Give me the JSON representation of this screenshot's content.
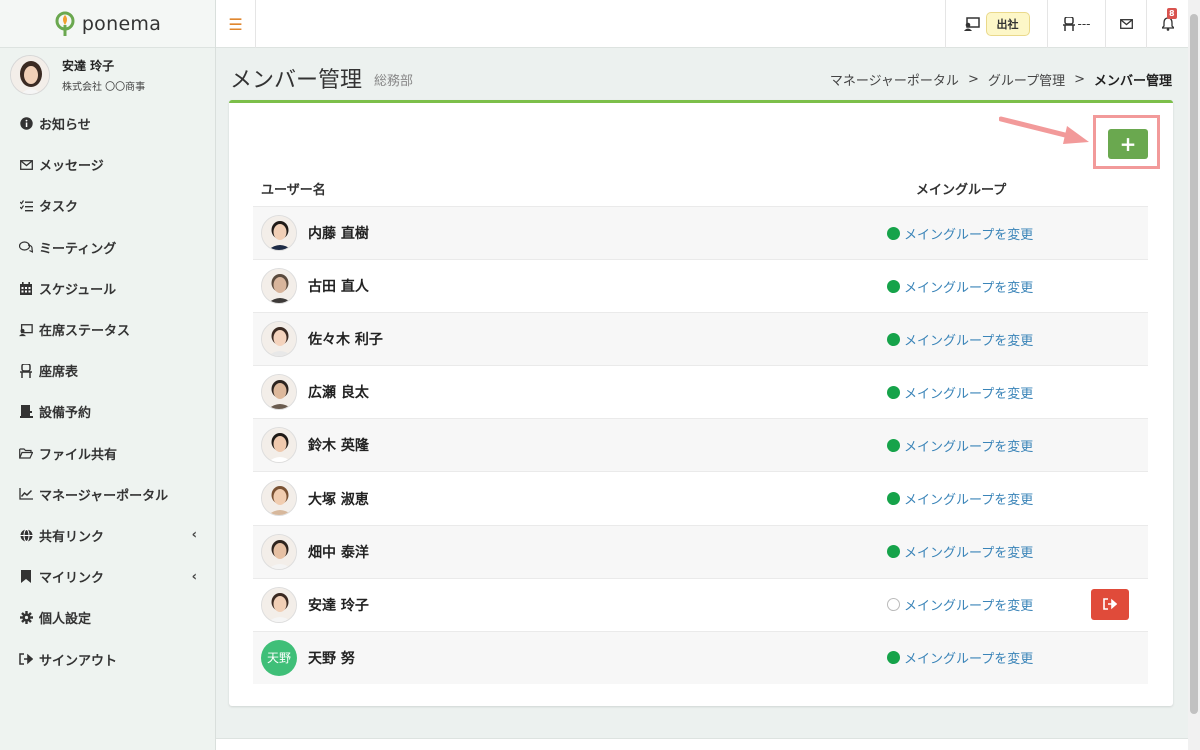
{
  "app": {
    "brand": "ponema"
  },
  "user": {
    "name": "安達 玲子",
    "company": "株式会社 〇〇商事"
  },
  "sidebar": {
    "items": [
      {
        "label": "お知らせ",
        "icon": "info-icon"
      },
      {
        "label": "メッセージ",
        "icon": "envelope-icon"
      },
      {
        "label": "タスク",
        "icon": "task-list-icon"
      },
      {
        "label": "ミーティング",
        "icon": "chat-bubbles-icon"
      },
      {
        "label": "スケジュール",
        "icon": "calendar-icon"
      },
      {
        "label": "在席ステータス",
        "icon": "presence-icon"
      },
      {
        "label": "座席表",
        "icon": "chair-icon"
      },
      {
        "label": "設備予約",
        "icon": "facility-icon"
      },
      {
        "label": "ファイル共有",
        "icon": "folder-icon"
      },
      {
        "label": "マネージャーポータル",
        "icon": "chart-icon"
      },
      {
        "label": "共有リンク",
        "icon": "globe-icon",
        "chevron": "‹"
      },
      {
        "label": "マイリンク",
        "icon": "bookmark-icon",
        "chevron": "‹"
      },
      {
        "label": "個人設定",
        "icon": "gear-icon"
      },
      {
        "label": "サインアウト",
        "icon": "sign-out-icon"
      }
    ]
  },
  "header": {
    "attendance_label": "出社",
    "seat_label": "---",
    "notification_count": "8"
  },
  "page": {
    "title": "メンバー管理",
    "subtitle": "総務部",
    "breadcrumb": [
      "マネージャーポータル",
      "グループ管理",
      "メンバー管理"
    ],
    "breadcrumb_sep": ">"
  },
  "table": {
    "col_user": "ユーザー名",
    "col_group": "メイングループ",
    "add_label": "+",
    "rows": [
      {
        "name": "内藤 直樹",
        "group_link": "メイングループを変更",
        "main": true
      },
      {
        "name": "古田 直人",
        "group_link": "メイングループを変更",
        "main": true
      },
      {
        "name": "佐々木 利子",
        "group_link": "メイングループを変更",
        "main": true
      },
      {
        "name": "広瀬 良太",
        "group_link": "メイングループを変更",
        "main": true
      },
      {
        "name": "鈴木 英隆",
        "group_link": "メイングループを変更",
        "main": true
      },
      {
        "name": "大塚 淑恵",
        "group_link": "メイングループを変更",
        "main": true
      },
      {
        "name": "畑中 泰洋",
        "group_link": "メイングループを変更",
        "main": true
      },
      {
        "name": "安達 玲子",
        "group_link": "メイングループを変更",
        "main": false,
        "leave": true
      },
      {
        "name": "天野 努",
        "group_link": "メイングループを変更",
        "main": true,
        "initials": "天野"
      }
    ]
  },
  "colors": {
    "accent_green": "#7cbf4a",
    "add_button": "#6aa84f",
    "danger": "#e04b3a",
    "link": "#3a84b8",
    "status_green": "#16a34a",
    "highlight_frame": "#f29a9a"
  }
}
